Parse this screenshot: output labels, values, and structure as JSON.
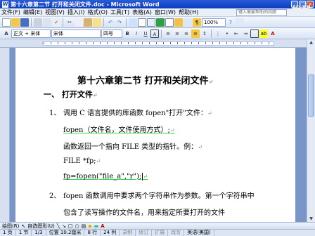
{
  "window": {
    "title": "第十六章第二节 打开和关闭文件.doc - Microsoft Word",
    "app_icon": "W"
  },
  "watermark": {
    "text": "优酷"
  },
  "menu": [
    "文件(F)",
    "编辑(E)",
    "视图(V)",
    "插入(I)",
    "格式(O)",
    "工具(T)",
    "表格(A)",
    "窗口(W)",
    "帮助(H)"
  ],
  "help_box": {
    "placeholder": "键入需要帮助的问题"
  },
  "toolbar": {
    "zoom": "100%"
  },
  "format_bar": {
    "style": "正文 + 宋体",
    "font": "宋体",
    "size": "四号",
    "bold": "B",
    "italic": "I",
    "underline": "U",
    "char_a": "A"
  },
  "document": {
    "heading": "第十六章第二节  打开和关闭文件",
    "section1": "一、  打开文件",
    "item1_num": "1、",
    "item1_text": "调用 C 语言提供的库函数 fopen\"打开\"文件：",
    "syntax": "fopen（文件名，文件使用方式）;",
    "returns": "函数返回一个指向 FILE 类型的指针。例：",
    "decl": "FILE *fp;",
    "call": "fp=fopen(\"file_a\",\"r\");",
    "item2_num": "2、",
    "item2_text": "fopen 函数调用中要求两个字符串作为参数。第一个字符串中",
    "item2_cont": "包含了读写操作的文件名，用来指定所要打开的文件"
  },
  "drawing_bar": {
    "draw": "绘图(R)",
    "autoshapes": "自选图形(U)"
  },
  "status": {
    "page": "1 页",
    "section": "1 节",
    "pages": "1/3",
    "position": "位置 10.2厘米",
    "line": "8 行",
    "col": "24 列",
    "rec": "录制",
    "rev": "修订",
    "ext": "扩展",
    "ovr": "改写",
    "lang": "英语(美国)"
  }
}
